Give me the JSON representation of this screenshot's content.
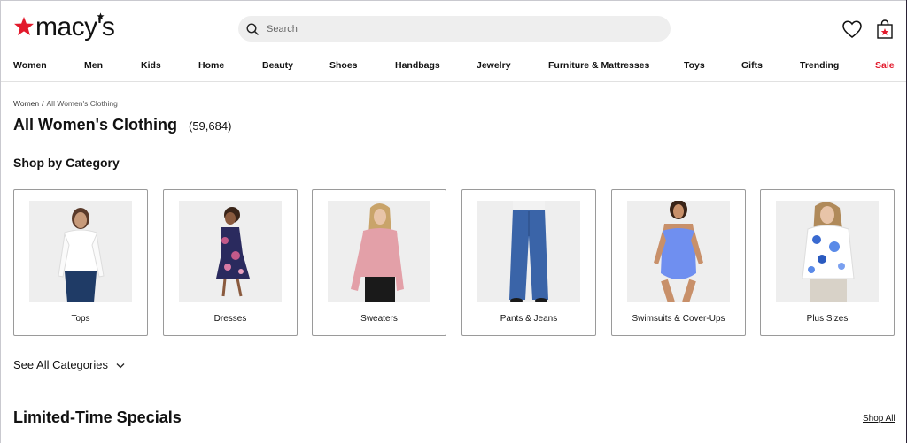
{
  "brand": {
    "name": "macy's",
    "accent": "#e21a2c"
  },
  "search": {
    "placeholder": "Search"
  },
  "header_icons": {
    "wishlist": "heart-icon",
    "bag": "shopping-bag-icon"
  },
  "nav": {
    "items": [
      "Women",
      "Men",
      "Kids",
      "Home",
      "Beauty",
      "Shoes",
      "Handbags",
      "Jewelry",
      "Furniture & Mattresses",
      "Toys",
      "Gifts",
      "Trending",
      "Sale"
    ]
  },
  "breadcrumb": {
    "parent": "Women",
    "separator": "/",
    "current": "All Women's Clothing"
  },
  "page": {
    "title": "All Women's Clothing",
    "count": "(59,684)"
  },
  "shop_by_category": {
    "title": "Shop by Category",
    "categories": [
      {
        "label": "Tops"
      },
      {
        "label": "Dresses"
      },
      {
        "label": "Sweaters"
      },
      {
        "label": "Pants & Jeans"
      },
      {
        "label": "Swimsuits & Cover-Ups"
      },
      {
        "label": "Plus Sizes"
      }
    ],
    "see_all": "See All Categories"
  },
  "specials": {
    "title": "Limited-Time Specials",
    "link": "Shop All"
  }
}
